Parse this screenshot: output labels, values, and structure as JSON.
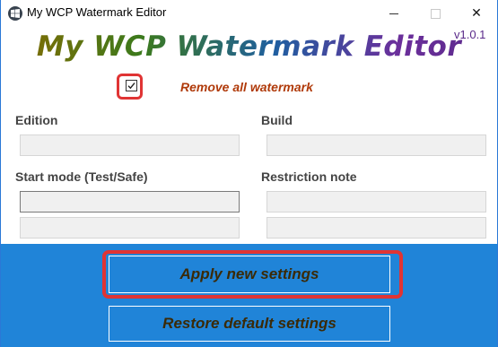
{
  "window": {
    "title": "My WCP Watermark Editor",
    "close_glyph": "✕"
  },
  "header": {
    "title": "My WCP Watermark Editor",
    "version": "v1.0.1"
  },
  "options": {
    "remove_watermark_label": "Remove all watermark",
    "remove_watermark_checked": true
  },
  "fields": {
    "edition_label": "Edition",
    "edition_value": "",
    "build_label": "Build",
    "build_value": "",
    "start_mode_label": "Start mode (Test/Safe)",
    "start_mode_value_1": "",
    "start_mode_value_2": "",
    "restriction_label": "Restriction note",
    "restriction_value_1": "",
    "restriction_value_2": ""
  },
  "actions": {
    "apply_label": "Apply new settings",
    "restore_label": "Restore default settings"
  },
  "colors": {
    "accent_panel": "#2084d8",
    "highlight": "#e03434",
    "label_text": "#b03a0a"
  }
}
